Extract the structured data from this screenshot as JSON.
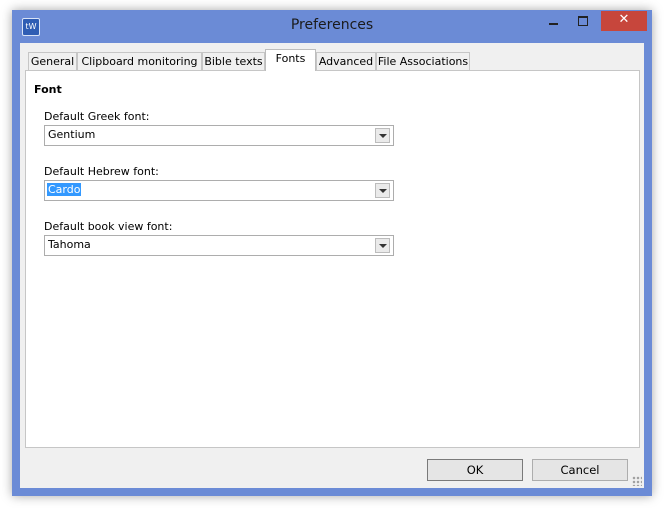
{
  "window": {
    "title": "Preferences",
    "app_icon_text": "tW"
  },
  "tabs": [
    {
      "label": "General",
      "active": false
    },
    {
      "label": "Clipboard monitoring",
      "active": false
    },
    {
      "label": "Bible texts",
      "active": false
    },
    {
      "label": "Fonts",
      "active": true
    },
    {
      "label": "Advanced",
      "active": false
    },
    {
      "label": "File Associations",
      "active": false
    }
  ],
  "fonts": {
    "section_title": "Font",
    "greek": {
      "label": "Default Greek font:",
      "value": "Gentium"
    },
    "hebrew": {
      "label": "Default Hebrew font:",
      "value": "Cardo"
    },
    "book_view": {
      "label": "Default book view font:",
      "value": "Tahoma"
    }
  },
  "buttons": {
    "ok": "OK",
    "cancel": "Cancel"
  },
  "colors": {
    "frame": "#6b8bd6",
    "close_button": "#c7463c",
    "selection": "#3399ff"
  },
  "icons": [
    "minimize-icon",
    "maximize-icon",
    "close-icon",
    "dropdown-arrow-icon",
    "resize-grip-icon"
  ]
}
